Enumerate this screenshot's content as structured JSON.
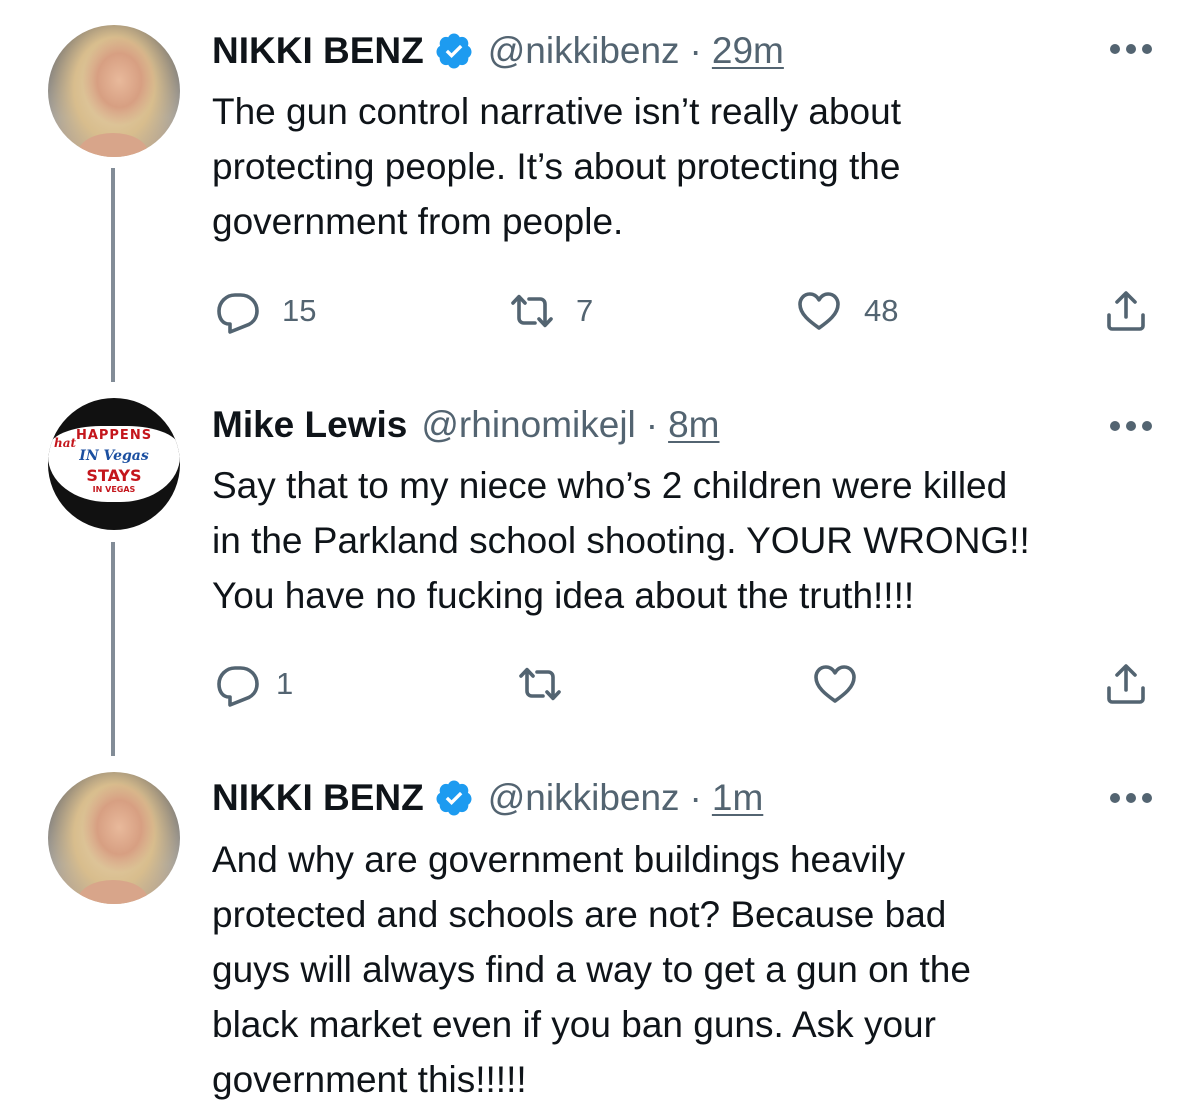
{
  "thread": [
    {
      "author": {
        "name": "NIKKI BENZ",
        "handle": "@nikkibenz",
        "verified": true,
        "avatar": "nikki-benz-avatar"
      },
      "separator": "·",
      "time": "29m",
      "text_lines": [
        "The gun control narrative isn’t really about",
        "protecting people. It’s about protecting the",
        "government from people."
      ],
      "actions": {
        "replies": "15",
        "retweets": "7",
        "likes": "48"
      }
    },
    {
      "author": {
        "name": "Mike Lewis",
        "handle": "@rhinomikejl",
        "verified": false,
        "avatar": "vegas-sign-avatar",
        "avatar_text": {
          "corner": "hat",
          "top": "HAPPENS",
          "in": "IN Vegas",
          "stays": "STAYS",
          "bottom": "IN VEGAS"
        }
      },
      "separator": "·",
      "time": "8m",
      "text_lines": [
        "Say that to my niece who’s 2 children were killed",
        "in the Parkland school shooting. YOUR WRONG!!",
        "You have no fucking idea about the truth!!!!"
      ],
      "actions": {
        "replies": "1",
        "retweets": "",
        "likes": ""
      }
    },
    {
      "author": {
        "name": "NIKKI BENZ",
        "handle": "@nikkibenz",
        "verified": true,
        "avatar": "nikki-benz-avatar"
      },
      "separator": "·",
      "time": "1m",
      "text_lines": [
        "And why are government buildings heavily",
        "protected and schools are not?  Because bad",
        "guys will always find a way to get a gun on the",
        "black market even if you ban guns. Ask your",
        "government this!!!!!"
      ]
    }
  ],
  "colors": {
    "text": "#0f1419",
    "secondary": "#536471",
    "verified": "#1d9bf0",
    "thread_line": "#828c97"
  },
  "icons": [
    "reply-icon",
    "retweet-icon",
    "like-icon",
    "share-icon",
    "more-icon",
    "verified-badge-icon"
  ]
}
